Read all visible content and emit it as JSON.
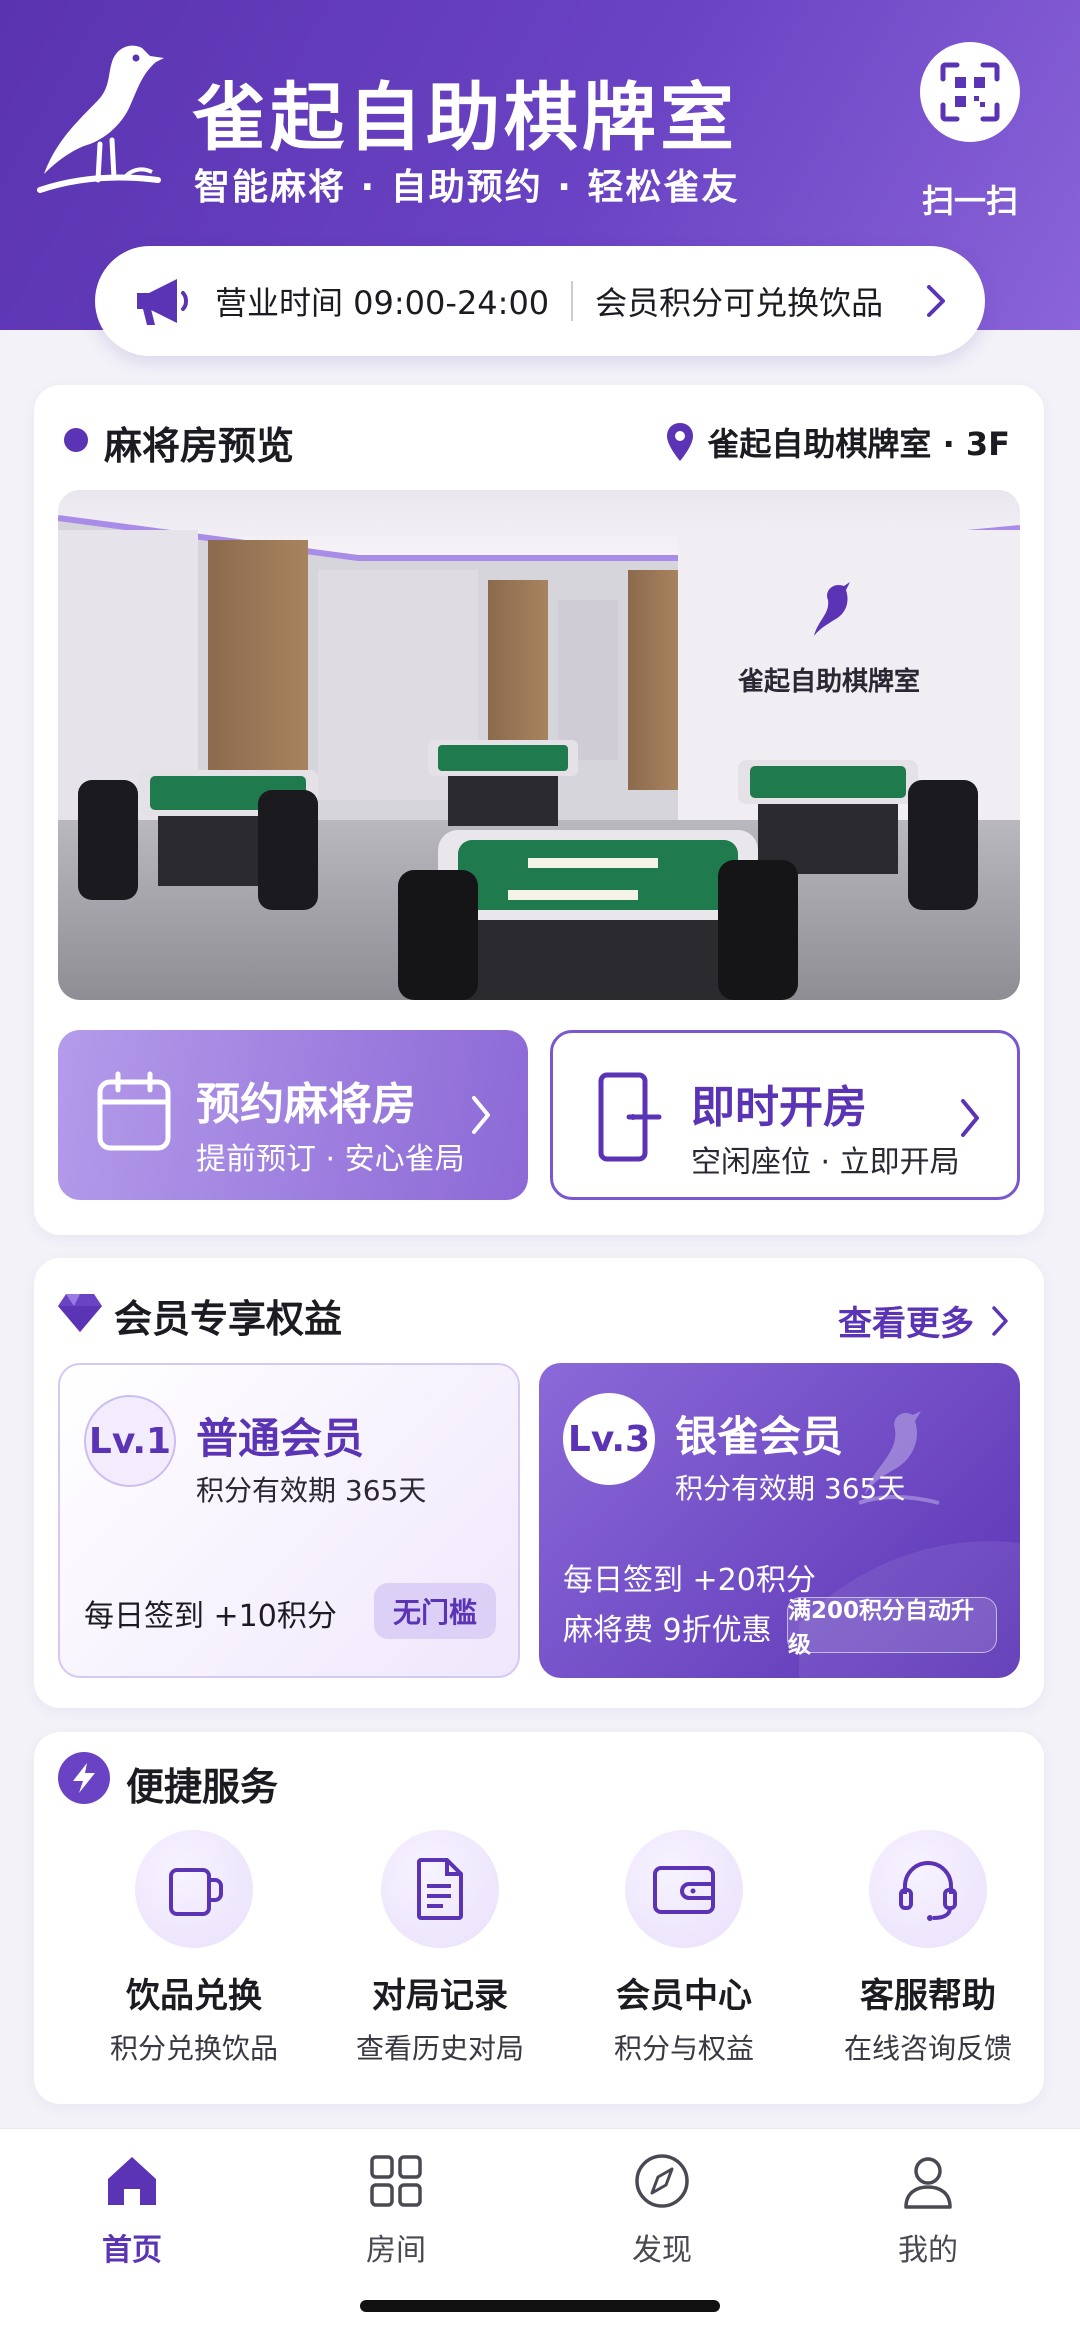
{
  "header": {
    "title": "雀起自助棋牌室",
    "subtitle": "智能麻将 · 自助预约 · 轻松雀友",
    "scan_label": "扫一扫",
    "logo_icon": "bird-logo-icon",
    "scan_icon": "qr-scan-icon"
  },
  "notice": {
    "icon": "megaphone-icon",
    "hours": "营业时间 09:00-24:00",
    "text": "会员积分可兑换饮品"
  },
  "room_preview": {
    "title": "麻将房预览",
    "location": "雀起自助棋牌室 · 3F",
    "wall_logo": "雀起自助棋牌室",
    "reserve": {
      "title": "预约麻将房",
      "subtitle": "提前预订 · 安心雀局",
      "icon": "calendar-icon"
    },
    "instant": {
      "title": "即时开房",
      "subtitle": "空闲座位 · 立即开局",
      "icon": "door-icon"
    }
  },
  "membership": {
    "title": "会员专享权益",
    "more": "查看更多",
    "tiers": [
      {
        "level": "Lv.1",
        "name": "普通会员",
        "validity": "积分有效期 365天",
        "perks": [
          "每日签到 +10积分"
        ],
        "tag": "无门槛"
      },
      {
        "level": "Lv.3",
        "name": "银雀会员",
        "validity": "积分有效期 365天",
        "perks": [
          "每日签到 +20积分",
          "麻将费 9折优惠"
        ],
        "tag": "满200积分自动升级"
      }
    ]
  },
  "services": {
    "title": "便捷服务",
    "items": [
      {
        "name": "饮品兑换",
        "sub": "积分兑换饮品",
        "icon": "cup-icon"
      },
      {
        "name": "对局记录",
        "sub": "查看历史对局",
        "icon": "document-icon"
      },
      {
        "name": "会员中心",
        "sub": "积分与权益",
        "icon": "wallet-icon"
      },
      {
        "name": "客服帮助",
        "sub": "在线咨询反馈",
        "icon": "headset-icon"
      }
    ]
  },
  "tabbar": {
    "items": [
      {
        "label": "首页",
        "icon": "home-icon",
        "active": true
      },
      {
        "label": "房间",
        "icon": "grid-icon",
        "active": false
      },
      {
        "label": "发现",
        "icon": "compass-icon",
        "active": false
      },
      {
        "label": "我的",
        "icon": "user-icon",
        "active": false
      }
    ]
  },
  "colors": {
    "primary": "#5b34b5",
    "accent_light": "#b49bea",
    "felt_green": "#1f7a4e"
  }
}
